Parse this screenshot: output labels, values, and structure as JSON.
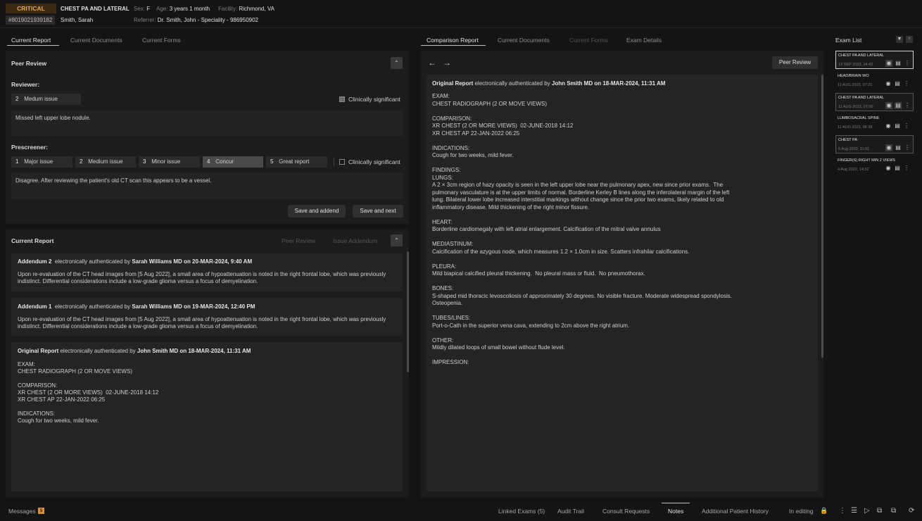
{
  "header": {
    "status": "CRITICAL",
    "exam_title": "CHEST PA AND LATERAL",
    "sex_label": "Sex:",
    "sex": "F",
    "age_label": "Age:",
    "age": "3 years 1 month",
    "facility_label": "Facility:",
    "facility": "Richmond, VA",
    "mrn": "#8019021939182",
    "patient": "Smith, Sarah",
    "referrer_label": "Referrer:",
    "referrer": "Dr. Smith, John - Speciality - 986950902"
  },
  "left_tabs": [
    "Current Report",
    "Current Documents",
    "Current Forms"
  ],
  "peer_review": {
    "title": "Peer Review",
    "collapse_icon": "chevron-up-icon",
    "reviewer_label": "Reviewer:",
    "reviewer_num": "2",
    "reviewer_value": "Medum issue",
    "clin_sig": "Clinically significant",
    "reviewer_comment": "Missed left upper lobe nodule.",
    "prescreener_label": "Prescreener:",
    "options": [
      {
        "n": "1",
        "label": "Major issue"
      },
      {
        "n": "2",
        "label": "Medium issue"
      },
      {
        "n": "3",
        "label": "Minor issue"
      },
      {
        "n": "4",
        "label": "Concur"
      },
      {
        "n": "5",
        "label": "Great report"
      }
    ],
    "clin_sig2": "Clinically significant",
    "prescreener_comment": "Disagree. After reviewing the patient's old CT scan this appears to be a vessel.",
    "save_addend": "Save and addend",
    "save_next": "Save and next"
  },
  "current_report": {
    "title": "Current Report",
    "peer_review": "Peer Review",
    "issue_addendum": "Issue Addendum",
    "add2": {
      "title": "Addendum 2",
      "auth": "electronically authenticated by",
      "by": "Sarah Williams MD on 20-MAR-2024, 9:40 AM",
      "text": "Upon re-evaluation of the CT head images from [5 Aug 2022], a small area of hypoattenuation is noted in the right frontal lobe, which was previously indistinct. Differential considerations include a low-grade glioma versus a focus of demyelination."
    },
    "add1": {
      "title": "Addendum 1",
      "auth": "electronically authenticated by",
      "by": "Sarah Williams MD on 19-MAR-2024, 12:40 PM",
      "text": "Upon re-evaluation of the CT head images from [5 Aug 2022], a small area of hypoattenuation is noted in the right frontal lobe, which was previously indistinct. Differential considerations include a low-grade glioma versus a focus of demyelination."
    },
    "orig": {
      "title": "Original Report",
      "auth": "electronically authenticated by",
      "by": "John Smith MD on 18-MAR-2024, 11:31 AM",
      "body": "EXAM:\nCHEST RADIOGRAPH (2 OR MOVE VIEWS)\n\nCOMPARISON:\nXR CHEST (2 OR MORE VIEWS)  02-JUNE-2018 14:12\nXR CHEST AP 22-JAN-2022 06:25\n\nINDICATIONS:\nCough for two weeks, mild fever."
    }
  },
  "mid_tabs": [
    "Comparison Report",
    "Current Documents",
    "Current Forms",
    "Exam Details"
  ],
  "comparison": {
    "back_icon": "arrow-left-icon",
    "fwd_icon": "arrow-right-icon",
    "peer_review": "Peer Review",
    "title": "Original Report",
    "auth": "electronically authenticated by",
    "by": "John Smith MD on 18-MAR-2024, 11:31 AM",
    "body": "EXAM:\nCHEST RADIOGRAPH (2 OR MOVE VIEWS)\n\nCOMPARISON:\nXR CHEST (2 OR MORE VIEWS)  02-JUNE-2018 14:12\nXR CHEST AP 22-JAN-2022 06:25\n\nINDICATIONS:\nCough for two weeks, mild fever.\n\nFINDINGS:\nLUNGS:\nA 2 × 3cm region of hazy opacity is seen in the left upper lobe near the pulmonary apex, new since prior exams.  The\npulmonary vasculature is at the upper limits of normal. Borderline Kerley B lines along the inferolateral margin of the left\nlung. Bilateral lower lobe increased interstitial markings without change since the prior two exams, likely related to old\ninflammatory disease. Mild thickening of the right minor fissure.\n\nHEART:\nBorderline cardiomegaly with left atrial enlargement. Calcification of the mitral valve annulus\n\nMEDIASTINUM:\nCalcification of the azygous node, which measures 1.2 × 1.0cm in size. Scatters infrahilar calcifications.\n\nPLEURA:\nMild biapical calcified pleural thickening.  No pleural mass or fluid.  No pneumothorax.\n\nBONES:\nS-shaped mid thoracic levoscoliosis of approximately 30 degrees. No visible fracture. Moderate widespread spondylosis.\nOsteopenia.\n\nTUBES/LINES:\nPort-o-Cath in the superior vena cava, extending to 2cm above the right atrium.\n\nOTHER:\nMildly dilated loops of small bowel without flude level.\n\nIMPRESSION:"
  },
  "exam_list": {
    "title": "Exam List",
    "items": [
      {
        "title": "CHEST PA AND LATERAL",
        "date": "13 SEP 2023, 14:43"
      },
      {
        "title": "HEAD/BRAIN WO",
        "date": "11 AUG 2023, 07:21"
      },
      {
        "title": "CHEST PA AND LATERAL",
        "date": "11 AUG 2023, 07:00"
      },
      {
        "title": "LUMBOSACRAL SPINE",
        "date": "11 AUG 2023, 06:28"
      },
      {
        "title": "CHEST PA",
        "date": "5 Aug 2022, 11:01"
      },
      {
        "title": "FINGER(S) RIGHT MIN 2 VIEWS",
        "date": "4 Aug 2022, 14:32"
      }
    ]
  },
  "bottom": {
    "messages": "Messages",
    "msg_count": "5",
    "linked": "Linked Exams (5)",
    "audit": "Audit Trail",
    "consult": "Consult Requests",
    "notes": "Notes",
    "history": "Additional Patient History",
    "editing": "In editing"
  }
}
